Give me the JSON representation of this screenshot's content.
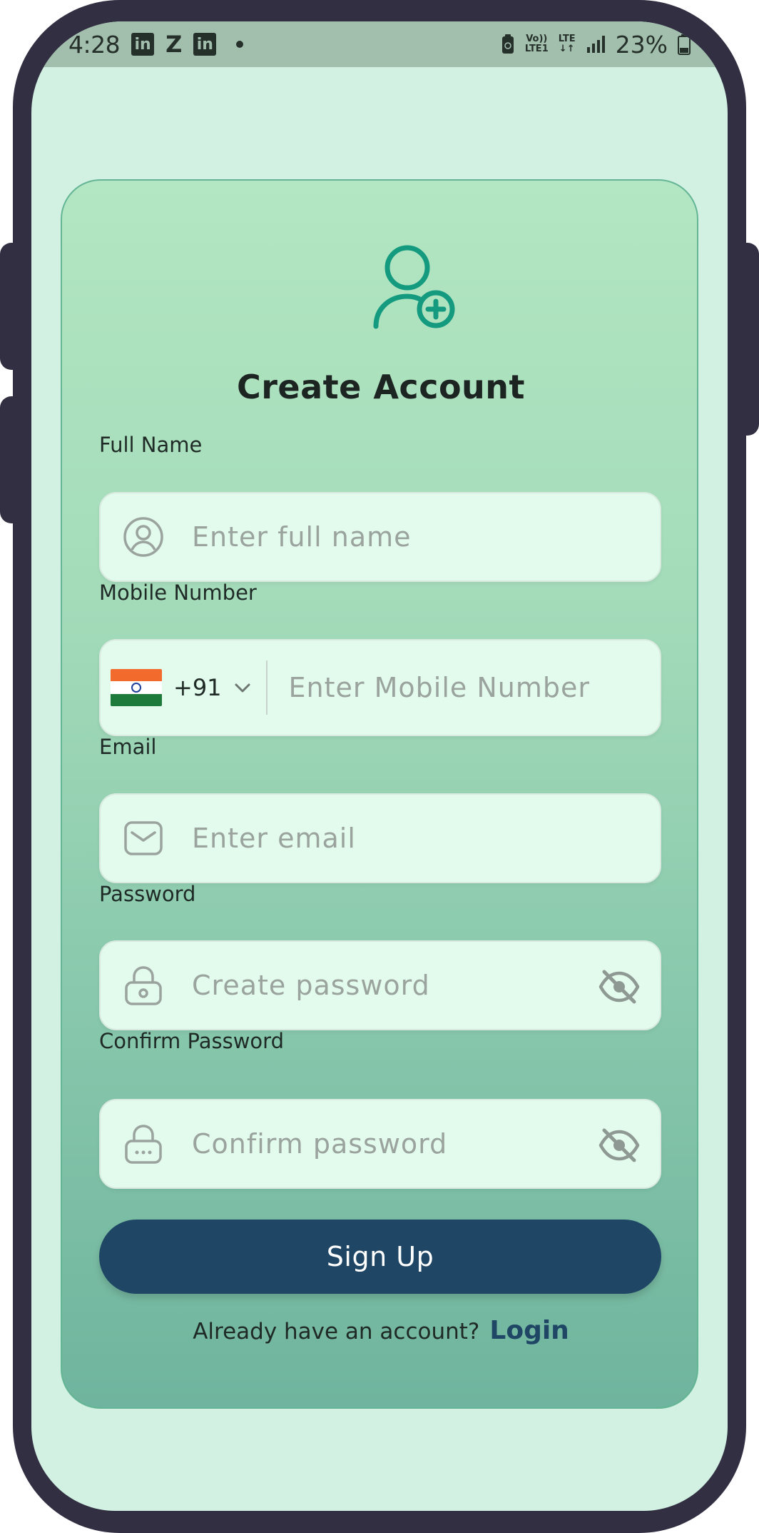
{
  "status_bar": {
    "time": "4:28",
    "icons": [
      "linkedin-icon",
      "zomato-icon",
      "linkedin-icon",
      "notification-dot-icon",
      "battery-saver-icon",
      "volte-icon",
      "lte-icon",
      "signal-icon",
      "battery-icon"
    ],
    "z_label": "Z",
    "li_label": "in",
    "volte_top": "Vo))",
    "volte_bottom": "LTE1",
    "lte_label": "LTE",
    "battery_percent": "23%"
  },
  "header": {
    "icon": "add-user-icon",
    "title": "Create Account"
  },
  "form": {
    "full_name": {
      "label": "Full Name",
      "placeholder": "Enter full name",
      "icon": "user-circle-icon"
    },
    "mobile": {
      "label": "Mobile Number",
      "country_flag": "india-flag-icon",
      "country_code": "+91",
      "placeholder": "Enter Mobile Number"
    },
    "email": {
      "label": "Email",
      "placeholder": "Enter email",
      "icon": "envelope-icon"
    },
    "password": {
      "label": "Password",
      "placeholder": "Create password",
      "icon": "lock-icon",
      "toggle_icon": "eye-off-icon"
    },
    "confirm_password": {
      "label": "Confirm Password",
      "placeholder": "Confirm password",
      "icon": "lock-dots-icon",
      "toggle_icon": "eye-off-icon"
    }
  },
  "actions": {
    "signup_label": "Sign Up",
    "login_prompt": "Already have an account?",
    "login_label": "Login"
  },
  "colors": {
    "primary": "#1f4765",
    "accent_teal": "#149a7f",
    "background": "#d2f1e2",
    "field_bg": "#e3fbec",
    "placeholder": "#9aa39e"
  }
}
